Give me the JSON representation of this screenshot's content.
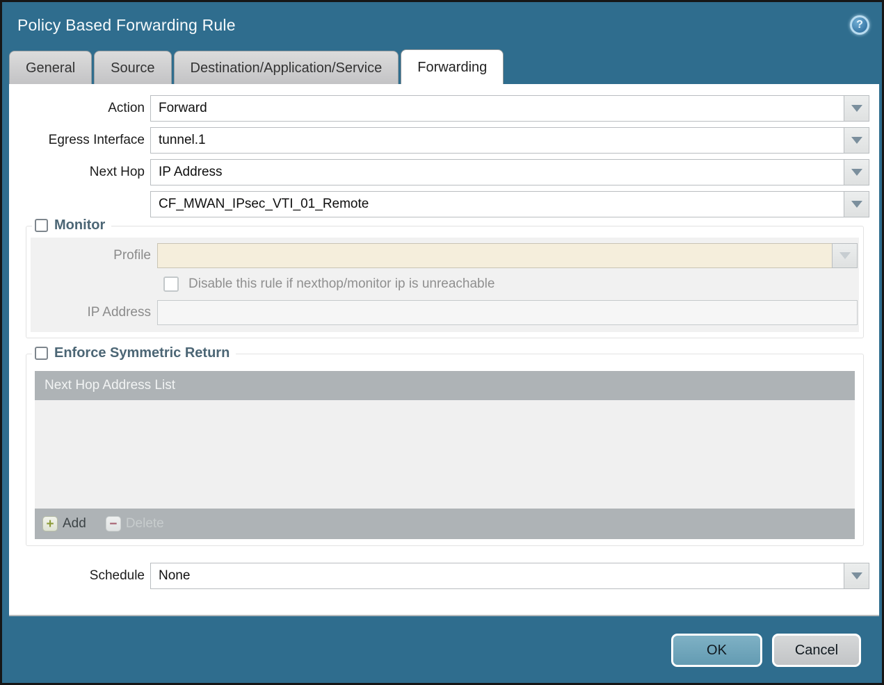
{
  "dialog": {
    "title": "Policy Based Forwarding Rule"
  },
  "icons": {
    "help": "?",
    "add": "+",
    "delete": "−"
  },
  "tabs": [
    {
      "label": "General"
    },
    {
      "label": "Source"
    },
    {
      "label": "Destination/Application/Service"
    },
    {
      "label": "Forwarding"
    }
  ],
  "form": {
    "action_label": "Action",
    "action_value": "Forward",
    "egress_label": "Egress Interface",
    "egress_value": "tunnel.1",
    "nexthop_label": "Next Hop",
    "nexthop_value": "IP Address",
    "nexthop_address_value": "CF_MWAN_IPsec_VTI_01_Remote",
    "schedule_label": "Schedule",
    "schedule_value": "None"
  },
  "monitor": {
    "legend": "Monitor",
    "checked": false,
    "profile_label": "Profile",
    "profile_value": "",
    "disable_label": "Disable this rule if nexthop/monitor ip is unreachable",
    "disable_checked": false,
    "ip_label": "IP Address",
    "ip_value": ""
  },
  "enforce": {
    "legend": "Enforce Symmetric Return",
    "checked": false,
    "table_header": "Next Hop Address List",
    "rows": [],
    "add_label": "Add",
    "delete_label": "Delete",
    "delete_enabled": false
  },
  "actions": {
    "ok": "OK",
    "cancel": "Cancel"
  },
  "colors": {
    "titlebar_teal": "#2f6d8e",
    "table_gray": "#aeb3b6",
    "disabled_cream": "#f5eedc",
    "ok_button_teal": "#6fa3b9",
    "legend_text": "#4c6675"
  }
}
